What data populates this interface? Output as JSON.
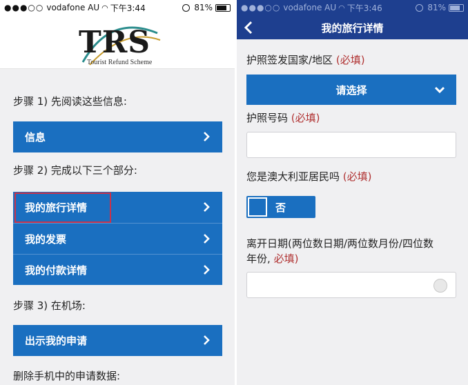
{
  "left": {
    "status": {
      "signal": "●●●○○",
      "carrier": "vodafone AU",
      "time": "下午3:44",
      "battery": "81%"
    },
    "logo": {
      "name": "TRS",
      "tagline": "Tourist Refund Scheme"
    },
    "step1": "步骤 1) 先阅读这些信息:",
    "info_button": "信息",
    "step2": "步骤 2) 完成以下三个部分:",
    "section_buttons": [
      "我的旅行详情",
      "我的发票",
      "我的付款详情"
    ],
    "step3": "步骤 3) 在机场:",
    "show_claim_button": "出示我的申请",
    "delete_text": "删除手机中的申请数据:"
  },
  "right": {
    "status": {
      "signal": "●●●○○",
      "carrier": "vodafone AU",
      "time": "下午3:46",
      "battery": "81%"
    },
    "title": "我的旅行详情",
    "passport_country_label": "护照签发国家/地区",
    "passport_country_required": "(必填)",
    "select_label": "请选择",
    "passport_number_label": "护照号码",
    "passport_number_required": "(必填)",
    "passport_number_value": "",
    "resident_label": "您是澳大利亚居民吗",
    "resident_required": "(必填)",
    "resident_toggle_label": "否",
    "departure_label_line1": "离开日期(两位数日期/两位数月份/四位数",
    "departure_label_line2": "年份,",
    "departure_required": "必填)",
    "departure_value": ""
  },
  "colors": {
    "button_blue": "#1a6fc0",
    "nav_blue": "#1e3f8f",
    "required_red": "#b03232",
    "highlight_red": "#c9324a"
  },
  "icons": [
    "chevron-right-icon",
    "chevron-down-icon",
    "back-arrow-icon",
    "calendar-icon",
    "wifi-icon",
    "battery-icon"
  ]
}
